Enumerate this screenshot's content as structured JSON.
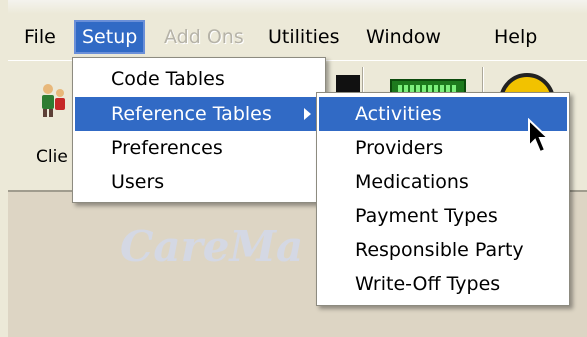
{
  "menubar": {
    "items": [
      {
        "label": "File"
      },
      {
        "label": "Setup"
      },
      {
        "label": "Add Ons"
      },
      {
        "label": "Utilities"
      },
      {
        "label": "Window"
      },
      {
        "label": "Help"
      }
    ]
  },
  "toolbar": {
    "clients_label": "Clie"
  },
  "workspace": {
    "watermark": "CareMa"
  },
  "setup_menu": {
    "items": [
      {
        "label": "Code Tables"
      },
      {
        "label": "Reference Tables"
      },
      {
        "label": "Preferences"
      },
      {
        "label": "Users"
      }
    ]
  },
  "reference_tables_menu": {
    "items": [
      {
        "label": "Activities"
      },
      {
        "label": "Providers"
      },
      {
        "label": "Medications"
      },
      {
        "label": "Payment Types"
      },
      {
        "label": "Responsible Party"
      },
      {
        "label": "Write-Off Types"
      }
    ]
  },
  "colors": {
    "highlight": "#316ac5",
    "menu_background": "#ece9d8",
    "workspace": "#ddd5c4"
  }
}
